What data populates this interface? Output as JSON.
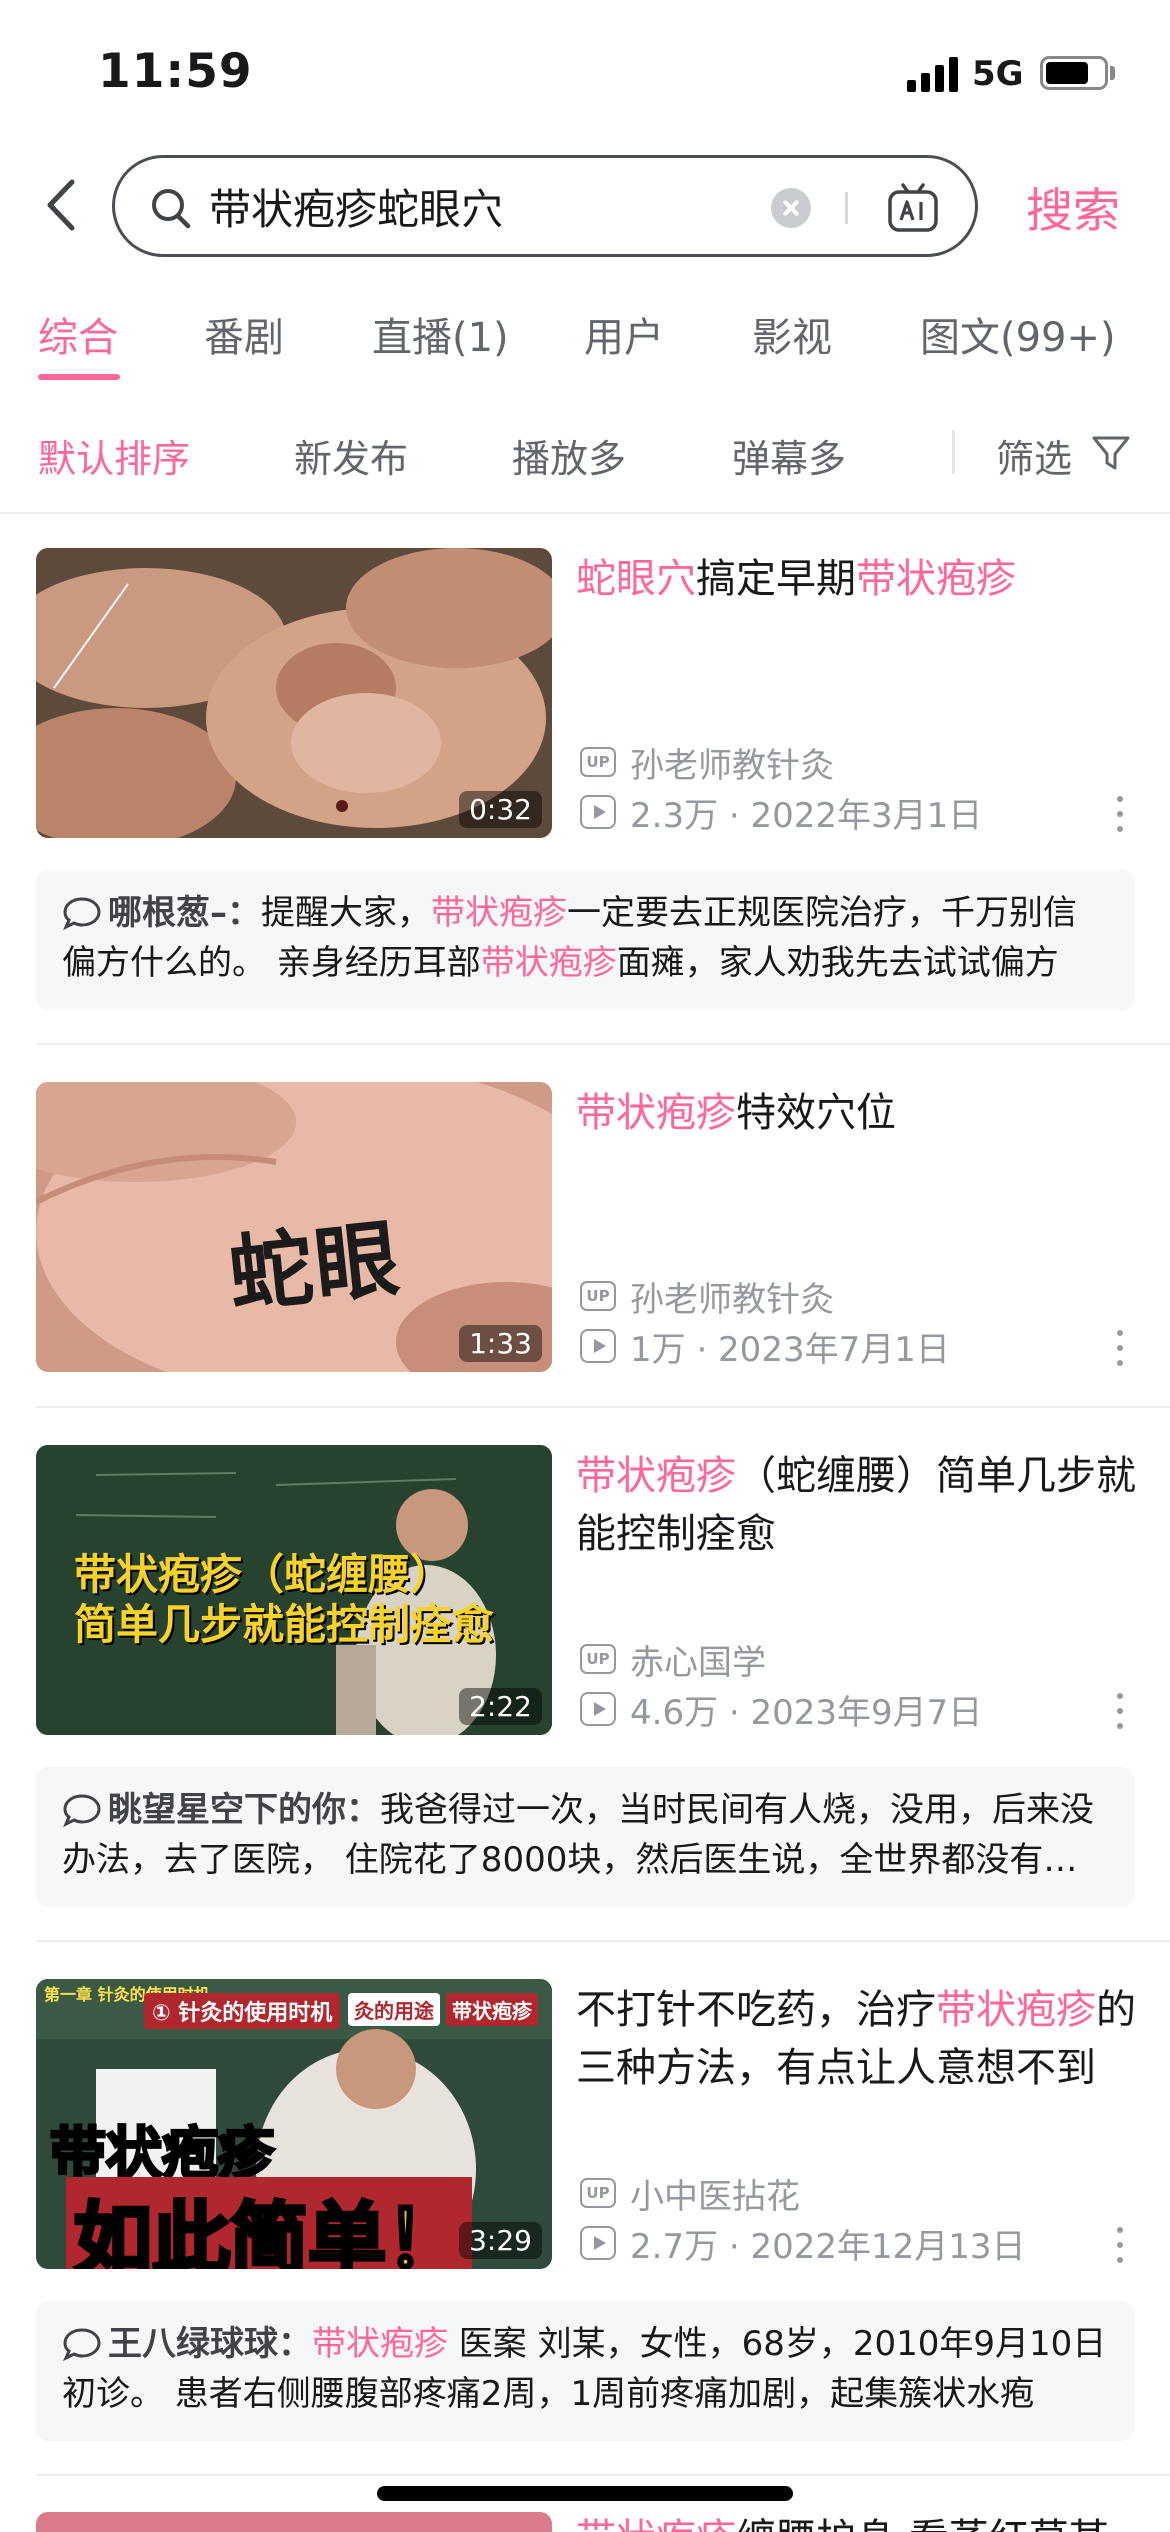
{
  "status_bar": {
    "time": "11:59",
    "network": "5G"
  },
  "search": {
    "query": "带状疱疹蛇眼穴",
    "submit_label": "搜索"
  },
  "tabs": [
    "综合",
    "番剧",
    "直播(1)",
    "用户",
    "影视",
    "图文(99+)"
  ],
  "sort": {
    "options": [
      "默认排序",
      "新发布",
      "播放多",
      "弹幕多"
    ],
    "filter_label": "筛选"
  },
  "results": [
    {
      "title_parts": [
        "蛇眼穴",
        "搞定早期",
        "带状疱疹"
      ],
      "duration": "0:32",
      "up_badge": "UP",
      "uploader": "孙老师教针灸",
      "stats": "2.3万 · 2022年3月1日",
      "comment": {
        "user": "哪根葱–：",
        "parts": [
          "提醒大家，",
          "带状疱疹",
          "一定要去正规医院治疗，千万别信偏方什么的。 亲身经历耳部",
          "带状疱疹",
          "面瘫，家人劝我先去试试偏方"
        ]
      }
    },
    {
      "title_parts": [
        "带状疱疹",
        "特效穴位"
      ],
      "duration": "1:33",
      "thumb_text": "蛇眼",
      "up_badge": "UP",
      "uploader": "孙老师教针灸",
      "stats": "1万 · 2023年7月1日"
    },
    {
      "title_parts": [
        "带状疱疹",
        "（蛇缠腰）简单几步就能控制痊愈"
      ],
      "duration": "2:22",
      "thumb_text": [
        "带状疱疹（蛇缠腰）",
        "简单几步就能控制痊愈"
      ],
      "up_badge": "UP",
      "uploader": "赤心国学",
      "stats": "4.6万 · 2023年9月7日",
      "comment": {
        "user": "眺望星空下的你：",
        "parts": [
          "我爸得过一次，当时民间有人烧，没用，后来没办法，去了医院， 住院花了8000块，然后医生说，全世界都没有特效药"
        ]
      }
    },
    {
      "title_parts": [
        "不打针不吃药，治疗",
        "带状疱疹",
        "的三种方法，有点让人意想不到"
      ],
      "duration": "3:29",
      "thumb_text": {
        "chapter": "第一章 针灸的使用时机",
        "section": "① 针灸的使用时机",
        "tag1": "灸的用途",
        "tag2": "带状疱疹",
        "big1": "带状疱疹",
        "big2": "如此简单！"
      },
      "up_badge": "UP",
      "uploader": "小中医拈花",
      "stats": "2.7万 · 2022年12月13日",
      "comment": {
        "user": "王八绿球球：",
        "parts": [
          "带状疱疹",
          " 医案 刘某，女性，68岁，2010年9月10日初诊。 患者右侧腰腹部疼痛2周，1周前疼痛加剧，起集簇状水疱"
        ]
      }
    },
    {
      "title_parts": [
        "带状疱疹",
        "缠腰护身 看蒸红草某"
      ]
    }
  ],
  "colors": {
    "accent": "#ff6699",
    "text": "#18191c",
    "muted": "#9499a0",
    "comment_bg": "#f6f7f8"
  },
  "icons": [
    "back-icon",
    "search-icon",
    "clear-icon",
    "ai-icon",
    "filter-icon",
    "up-icon",
    "play-count-icon",
    "more-icon",
    "comment-icon"
  ]
}
